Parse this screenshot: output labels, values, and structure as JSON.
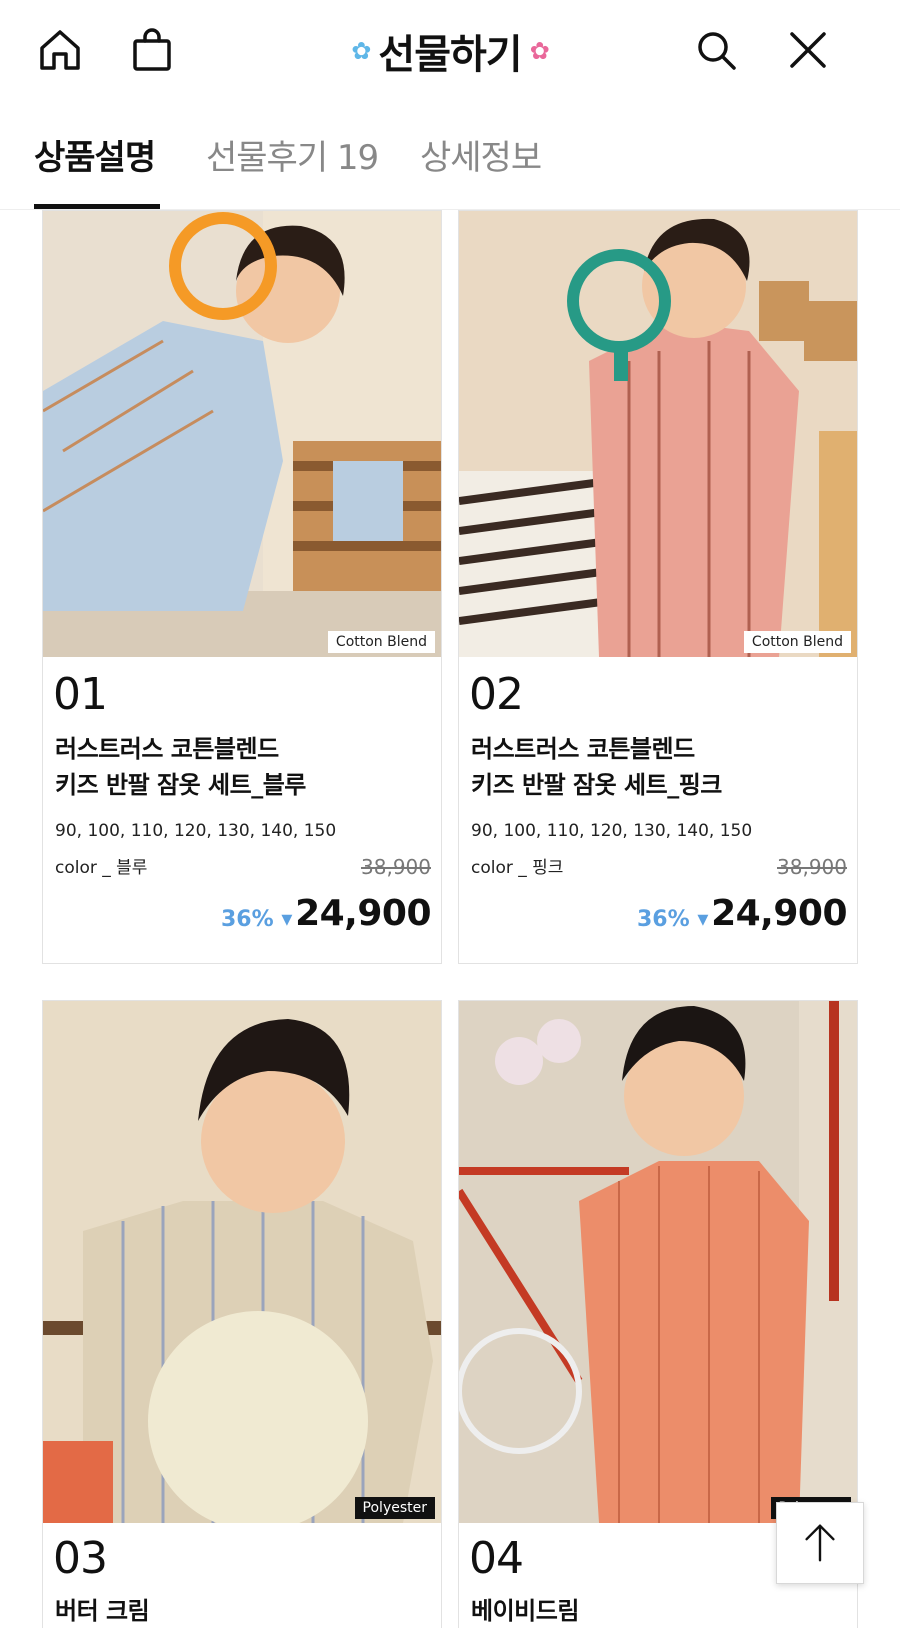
{
  "header": {
    "title": "선물하기",
    "left_icons": [
      "home-icon",
      "shopping-bag-icon"
    ],
    "right_icons": [
      "search-icon",
      "close-icon"
    ]
  },
  "tabs": [
    {
      "label": "상품설명",
      "active": true
    },
    {
      "label": "선물후기 19",
      "active": false
    },
    {
      "label": "상세정보",
      "active": false
    }
  ],
  "products": [
    {
      "number": "01",
      "name_line1": "러스트러스 코튼블렌드",
      "name_line2": "키즈 반팔 잠옷 세트_블루",
      "sizes": "90, 100, 110, 120, 130, 140, 150",
      "color": "color _ 블루",
      "original_price": "38,900",
      "discount": "36% ▾",
      "price": "24,900",
      "fabric": "Cotton Blend"
    },
    {
      "number": "02",
      "name_line1": "러스트러스 코튼블렌드",
      "name_line2": "키즈 반팔 잠옷 세트_핑크",
      "sizes": "90, 100, 110, 120, 130, 140, 150",
      "color": "color _ 핑크",
      "original_price": "38,900",
      "discount": "36% ▾",
      "price": "24,900",
      "fabric": "Cotton Blend"
    },
    {
      "number": "03",
      "name_line1": "버터 크림",
      "fabric": "Polyester"
    },
    {
      "number": "04",
      "name_line1": "베이비드림",
      "fabric": "Polyester"
    }
  ],
  "colors": {
    "discount": "#5a9fe0",
    "text": "#111111",
    "muted": "#888888"
  }
}
